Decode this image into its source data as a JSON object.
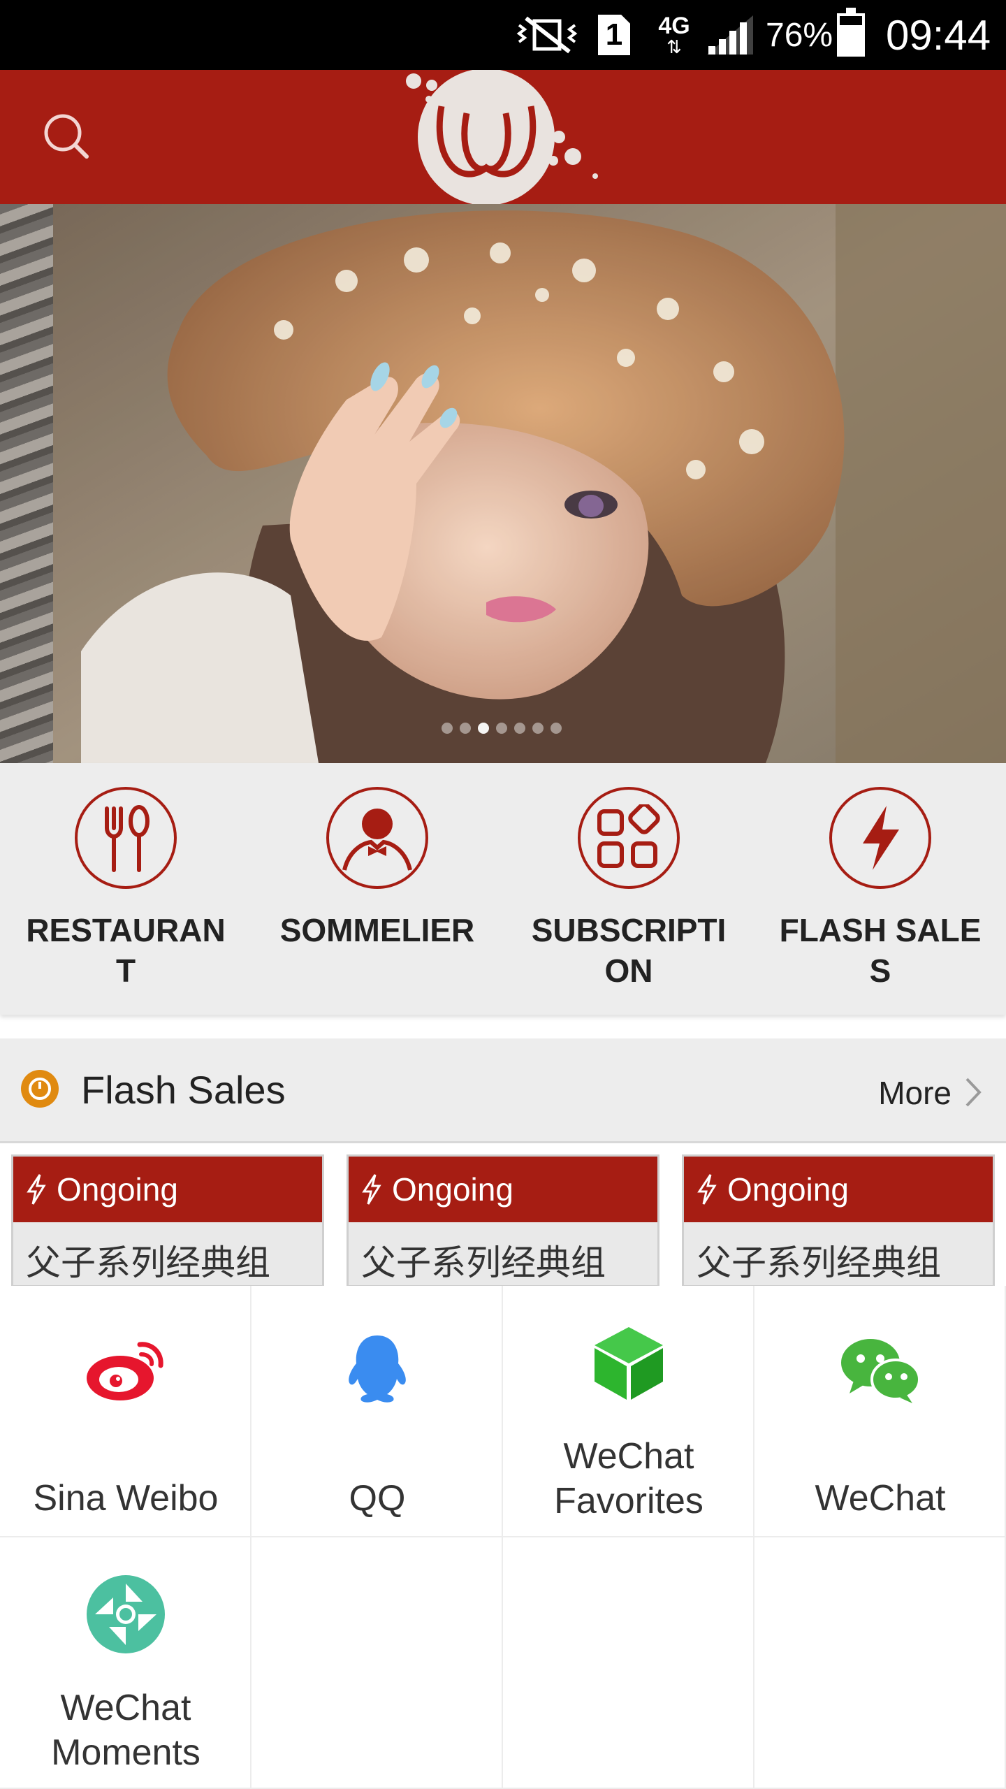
{
  "status_bar": {
    "sim_slot": "1",
    "network": "4G",
    "battery_percent": "76%",
    "battery_level": 0.76,
    "time": "09:44"
  },
  "header": {
    "search_icon": "search-icon",
    "logo_icon": "brand-logo"
  },
  "banner": {
    "slide_count": 7,
    "active_index": 2
  },
  "categories": [
    {
      "label": "RESTAURANT",
      "icon": "fork-spoon-icon"
    },
    {
      "label": "SOMMELIER",
      "icon": "person-bowtie-icon"
    },
    {
      "label": "SUBSCRIPTION",
      "icon": "grid-apps-icon"
    },
    {
      "label": "FLASH SALES",
      "icon": "lightning-icon"
    }
  ],
  "flash_sales": {
    "title": "Flash Sales",
    "more_label": "More",
    "items": [
      {
        "status": "Ongoing",
        "name": "父子系列经典组"
      },
      {
        "status": "Ongoing",
        "name": "父子系列经典组"
      },
      {
        "status": "Ongoing",
        "name": "父子系列经典组"
      }
    ]
  },
  "share": {
    "options": [
      {
        "label": "Sina Weibo",
        "icon": "weibo-icon"
      },
      {
        "label": "QQ",
        "icon": "qq-icon"
      },
      {
        "label": "WeChat Favorites",
        "icon": "wechat-favorites-icon"
      },
      {
        "label": "WeChat",
        "icon": "wechat-icon"
      },
      {
        "label": "WeChat Moments",
        "icon": "wechat-moments-icon"
      }
    ]
  },
  "colors": {
    "brand_red": "#a61d13",
    "weibo_red": "#e6162d",
    "qq_blue": "#3a8cf0",
    "wechat_green": "#2db52e",
    "moments_teal": "#4cc0a0",
    "timer_orange": "#e08a10"
  }
}
